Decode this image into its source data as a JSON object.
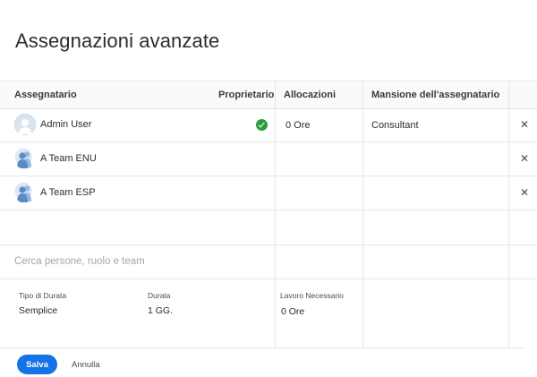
{
  "dialog": {
    "title": "Assegnazioni avanzate"
  },
  "table": {
    "headers": {
      "assignee": "Assegnatario",
      "owner": "Proprietario",
      "allocations": "Allocazioni",
      "role": "Mansione dell'assegnatario"
    },
    "rows": [
      {
        "name": "Admin User",
        "avatar": "user-avatar",
        "owner": true,
        "allocation": "0 Ore",
        "role": "Consultant"
      },
      {
        "name": "A Team ENU",
        "avatar": "team-icon",
        "owner": false,
        "allocation": "",
        "role": ""
      },
      {
        "name": "A Team ESP",
        "avatar": "team-icon",
        "owner": false,
        "allocation": "",
        "role": ""
      }
    ]
  },
  "search": {
    "placeholder": "Cerca persone, ruolo e team"
  },
  "duration": {
    "type_label": "Tipo di Durata",
    "type_value": "Semplice",
    "duration_label": "Durata",
    "duration_value": "1 GG.",
    "work_label": "Lavoro Necessario",
    "work_value": "0 Ore"
  },
  "footer": {
    "save_label": "Salva",
    "cancel_label": "Annulla"
  },
  "colors": {
    "accent": "#1473e6",
    "owner_check": "#2d9d3a",
    "team_icon": "#5b8bc7"
  }
}
